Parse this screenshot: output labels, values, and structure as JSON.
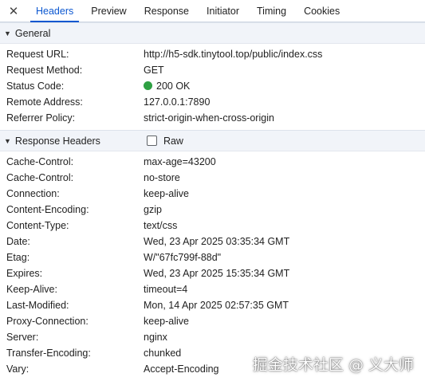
{
  "tabs": {
    "close_glyph": "✕",
    "items": [
      "Headers",
      "Preview",
      "Response",
      "Initiator",
      "Timing",
      "Cookies"
    ],
    "active": "Headers"
  },
  "general": {
    "title": "General",
    "rows": [
      {
        "key": "Request URL:",
        "value": "http://h5-sdk.tinytool.top/public/index.css"
      },
      {
        "key": "Request Method:",
        "value": "GET"
      },
      {
        "key": "Status Code:",
        "value": "200 OK"
      },
      {
        "key": "Remote Address:",
        "value": "127.0.0.1:7890"
      },
      {
        "key": "Referrer Policy:",
        "value": "strict-origin-when-cross-origin"
      }
    ]
  },
  "response_headers": {
    "title": "Response Headers",
    "raw_label": "Raw",
    "raw_checked": false,
    "rows": [
      {
        "key": "Cache-Control:",
        "value": "max-age=43200"
      },
      {
        "key": "Cache-Control:",
        "value": "no-store"
      },
      {
        "key": "Connection:",
        "value": "keep-alive"
      },
      {
        "key": "Content-Encoding:",
        "value": "gzip"
      },
      {
        "key": "Content-Type:",
        "value": "text/css"
      },
      {
        "key": "Date:",
        "value": "Wed, 23 Apr 2025 03:35:34 GMT"
      },
      {
        "key": "Etag:",
        "value": "W/\"67fc799f-88d\""
      },
      {
        "key": "Expires:",
        "value": "Wed, 23 Apr 2025 15:35:34 GMT"
      },
      {
        "key": "Keep-Alive:",
        "value": "timeout=4"
      },
      {
        "key": "Last-Modified:",
        "value": "Mon, 14 Apr 2025 02:57:35 GMT"
      },
      {
        "key": "Proxy-Connection:",
        "value": "keep-alive"
      },
      {
        "key": "Server:",
        "value": "nginx"
      },
      {
        "key": "Transfer-Encoding:",
        "value": "chunked"
      },
      {
        "key": "Vary:",
        "value": "Accept-Encoding"
      }
    ]
  },
  "watermark": "掘金技术社区 @ 义大师",
  "colors": {
    "accent": "#0b57d0",
    "status_ok": "#2ea043",
    "section_bg": "#f1f4f9"
  }
}
